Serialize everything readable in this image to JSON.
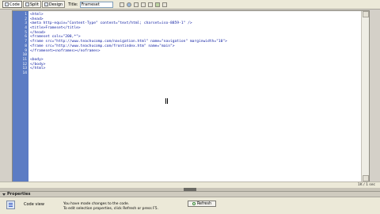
{
  "toolbar": {
    "code_label": "Code",
    "split_label": "Split",
    "design_label": "Design",
    "title_label": "Title:",
    "title_value": "Frameset"
  },
  "editor": {
    "line_numbers": [
      "1",
      "2",
      "3",
      "4",
      "5",
      "6",
      "7",
      "8",
      "9",
      "10",
      "11",
      "12",
      "13",
      "14"
    ],
    "lines": [
      "<html>",
      "<head>",
      "<meta http-equiv=\"Content-Type\" content=\"text/html; charset=iso-8859-1\" />",
      "<title>Frameset</title>",
      "</head>",
      "<frameset cols=\"200,*\">",
      "<frame src=\"http://www.teachucomp.com/navigation.html\" name=\"navigation\" marginwidth=\"10\">",
      "<frame src=\"http://www.teachucomp.com/frontindex.htm\" name=\"main\">",
      "</frameset><noframes></noframes>",
      "",
      "<body>",
      "</body>",
      "</html>",
      ""
    ]
  },
  "status": {
    "info": "1K / 1 sec"
  },
  "properties": {
    "header": "Properties",
    "view_label": "Code view",
    "message_line1": "You have made changes to the code.",
    "message_line2": "To edit selection properties, click Refresh or press F5.",
    "refresh_label": "Refresh"
  }
}
